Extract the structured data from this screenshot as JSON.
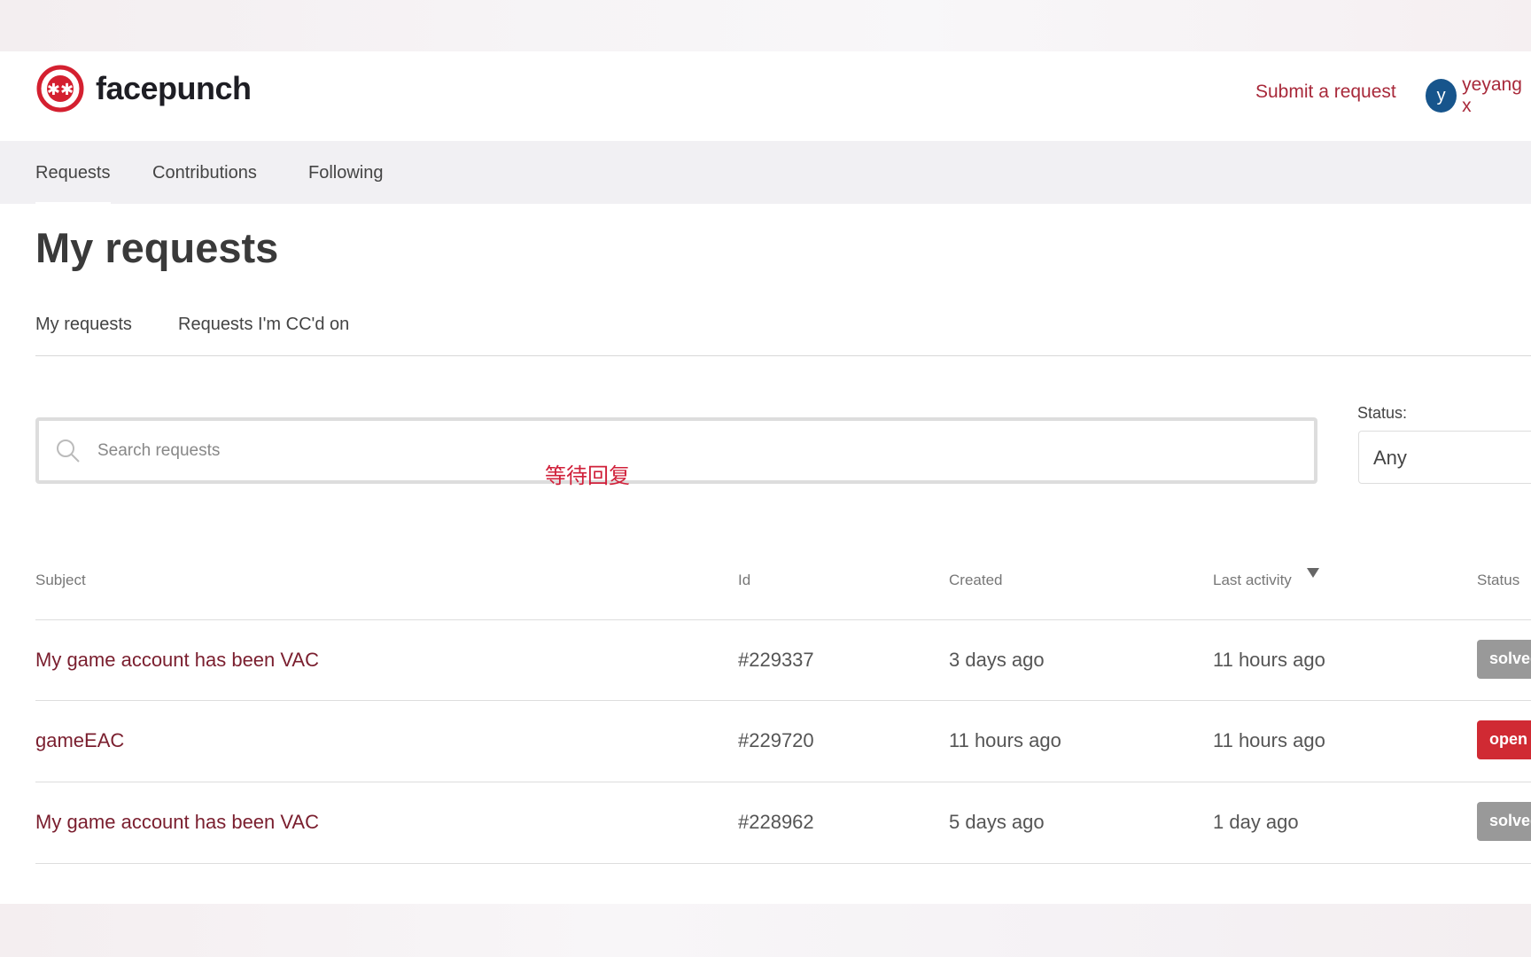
{
  "brand": {
    "name": "facepunch",
    "color": "#d42030"
  },
  "header": {
    "submit_label": "Submit a request",
    "avatar_letter": "y",
    "username": "yeyang x"
  },
  "nav": {
    "items": [
      {
        "label": "Requests",
        "active": true
      },
      {
        "label": "Contributions"
      },
      {
        "label": "Following"
      }
    ]
  },
  "page_title": "My requests",
  "subtabs": [
    {
      "label": "My requests"
    },
    {
      "label": "Requests I'm CC'd on"
    }
  ],
  "search": {
    "placeholder": "Search requests",
    "value": ""
  },
  "annotation": "等待回复",
  "status_filter": {
    "label": "Status:",
    "value": "Any"
  },
  "table": {
    "headers": [
      "Subject",
      "Id",
      "Created",
      "Last activity",
      "Status"
    ],
    "sort": {
      "column": "Last activity",
      "direction": "desc"
    },
    "rows": [
      {
        "subject": "My game account has been VAC",
        "id": "#229337",
        "created": "3 days ago",
        "last_activity": "11 hours ago",
        "status": "solved",
        "status_color": "#999999"
      },
      {
        "subject": "gameEAC",
        "id": "#229720",
        "created": "11 hours ago",
        "last_activity": "11 hours ago",
        "status": "open",
        "status_color": "#d02a33"
      },
      {
        "subject": "My game account has been VAC",
        "id": "#228962",
        "created": "5 days ago",
        "last_activity": "1 day ago",
        "status": "solved",
        "status_color": "#999999"
      }
    ]
  }
}
